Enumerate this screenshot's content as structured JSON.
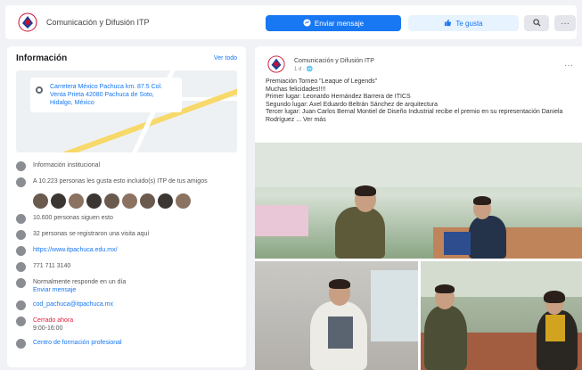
{
  "header": {
    "page_name": "Comunicación y Difusión ITP",
    "send_message_label": "Enviar mensaje",
    "like_label": "Te gusta",
    "more_label": "···"
  },
  "info": {
    "title": "Información",
    "see_all": "Ver todo",
    "address": "Carretera México Pachuca km. 87.5 Col. Venta Prieta 42080 Pachuca de Soto, Hidalgo, México",
    "rows": [
      {
        "icon": "info-icon",
        "text": "Información institucional"
      },
      {
        "icon": "thumbs-up-icon",
        "text": "A 10.223 personas les gusta esto incluido(s) ITP de tus amigos"
      },
      {
        "icon": "followers-icon",
        "text": "10.600 personas siguen esto"
      },
      {
        "icon": "checkin-icon",
        "text": "32 personas se registraron una visita aquí"
      },
      {
        "icon": "globe-icon",
        "text": "https://www.itpachuca.edu.mx/"
      },
      {
        "icon": "phone-icon",
        "text": "771 711 3140"
      },
      {
        "icon": "messenger-icon",
        "text": "Normalmente responde en un día",
        "link": "Enviar mensaje"
      },
      {
        "icon": "email-icon",
        "text": "cod_pachuca@itpachuca.mx"
      },
      {
        "icon": "clock-icon",
        "status": "Cerrado ahora",
        "hours": "9:00-16:00"
      },
      {
        "icon": "briefcase-icon",
        "text": "Centro de formación profesional"
      }
    ]
  },
  "post": {
    "author": "Comunicación y Difusión ITP",
    "time": "1 d · 🌐",
    "text": "Premiación Torneo \"Leaque of Legends\"\nMuchas felicidades!!!!\nPrimer lugar: Leonardo Hernández Barrera de ITICS\nSegundo lugar: Axel Eduardo Beltrán Sánchez de arquitectura\nTercer lugar: Juan Carlos Bernal Montiel de Diseño Industrial recibe el premio en su representación Daniela Rodríguez ... Ver más"
  },
  "colors": {
    "accent": "#1877f2",
    "background": "#f0f2f5",
    "status_closed": "#e41e3f"
  }
}
